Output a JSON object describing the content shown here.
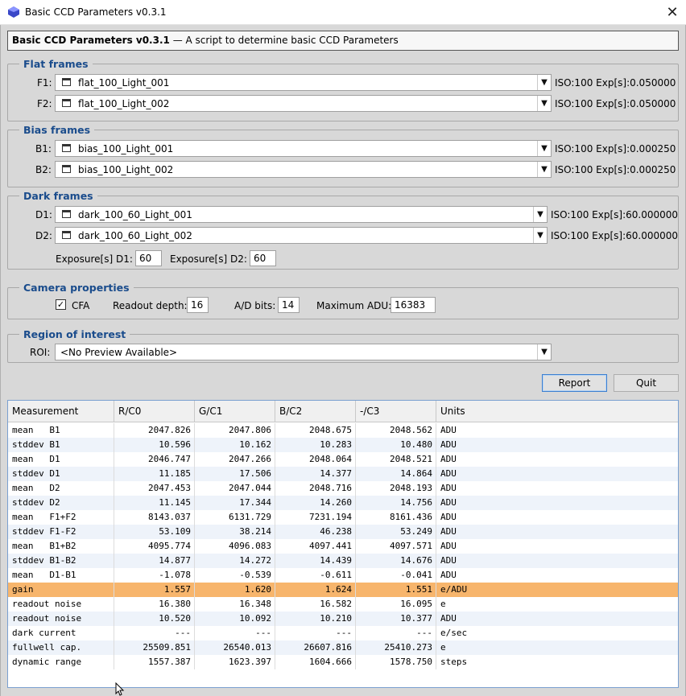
{
  "window": {
    "title": "Basic CCD Parameters v0.3.1",
    "close_glyph": "✕"
  },
  "header": {
    "name": "Basic CCD Parameters v0.3.1",
    "desc": " — A script to determine basic CCD Parameters"
  },
  "flat": {
    "legend": "Flat frames",
    "f1": {
      "label": "F1:",
      "value": "flat_100_Light_001",
      "info": "ISO:100 Exp[s]:0.050000"
    },
    "f2": {
      "label": "F2:",
      "value": "flat_100_Light_002",
      "info": "ISO:100 Exp[s]:0.050000"
    }
  },
  "bias": {
    "legend": "Bias frames",
    "b1": {
      "label": "B1:",
      "value": "bias_100_Light_001",
      "info": "ISO:100 Exp[s]:0.000250"
    },
    "b2": {
      "label": "B2:",
      "value": "bias_100_Light_002",
      "info": "ISO:100 Exp[s]:0.000250"
    }
  },
  "dark": {
    "legend": "Dark frames",
    "d1": {
      "label": "D1:",
      "value": "dark_100_60_Light_001",
      "info": "ISO:100 Exp[s]:60.000000"
    },
    "d2": {
      "label": "D2:",
      "value": "dark_100_60_Light_002",
      "info": "ISO:100 Exp[s]:60.000000"
    },
    "exp_d1_label": "Exposure[s] D1:",
    "exp_d1": "60",
    "exp_d2_label": "Exposure[s] D2:",
    "exp_d2": "60"
  },
  "camera": {
    "legend": "Camera properties",
    "cfa_label": "CFA",
    "cfa_checked": true,
    "check_glyph": "✓",
    "readout_label": "Readout depth:",
    "readout": "16",
    "adbits_label": "A/D bits:",
    "adbits": "14",
    "maxadu_label": "Maximum ADU:",
    "maxadu": "16383"
  },
  "roi": {
    "legend": "Region of interest",
    "label": "ROI:",
    "value": "<No Preview Available>"
  },
  "buttons": {
    "report": "Report",
    "quit": "Quit"
  },
  "table": {
    "headers": [
      "Measurement",
      "R/C0",
      "G/C1",
      "B/C2",
      "-/C3",
      "Units"
    ],
    "rows": [
      {
        "m": "mean   B1",
        "r": "2047.826",
        "g": "2047.806",
        "b": "2048.675",
        "c3": "2048.562",
        "u": "ADU"
      },
      {
        "m": "stddev B1",
        "r": "10.596",
        "g": "10.162",
        "b": "10.283",
        "c3": "10.480",
        "u": "ADU"
      },
      {
        "m": "mean   D1",
        "r": "2046.747",
        "g": "2047.266",
        "b": "2048.064",
        "c3": "2048.521",
        "u": "ADU"
      },
      {
        "m": "stddev D1",
        "r": "11.185",
        "g": "17.506",
        "b": "14.377",
        "c3": "14.864",
        "u": "ADU"
      },
      {
        "m": "mean   D2",
        "r": "2047.453",
        "g": "2047.044",
        "b": "2048.716",
        "c3": "2048.193",
        "u": "ADU"
      },
      {
        "m": "stddev D2",
        "r": "11.145",
        "g": "17.344",
        "b": "14.260",
        "c3": "14.756",
        "u": "ADU"
      },
      {
        "m": "mean   F1+F2",
        "r": "8143.037",
        "g": "6131.729",
        "b": "7231.194",
        "c3": "8161.436",
        "u": "ADU"
      },
      {
        "m": "stddev F1-F2",
        "r": "53.109",
        "g": "38.214",
        "b": "46.238",
        "c3": "53.249",
        "u": "ADU"
      },
      {
        "m": "mean   B1+B2",
        "r": "4095.774",
        "g": "4096.083",
        "b": "4097.441",
        "c3": "4097.571",
        "u": "ADU"
      },
      {
        "m": "stddev B1-B2",
        "r": "14.877",
        "g": "14.272",
        "b": "14.439",
        "c3": "14.676",
        "u": "ADU"
      },
      {
        "m": "mean   D1-B1",
        "r": "-1.078",
        "g": "-0.539",
        "b": "-0.611",
        "c3": "-0.041",
        "u": "ADU"
      },
      {
        "m": "gain",
        "r": "1.557",
        "g": "1.620",
        "b": "1.624",
        "c3": "1.551",
        "u": "e/ADU",
        "highlight": true
      },
      {
        "m": "readout noise",
        "r": "16.380",
        "g": "16.348",
        "b": "16.582",
        "c3": "16.095",
        "u": "e"
      },
      {
        "m": "readout noise",
        "r": "10.520",
        "g": "10.092",
        "b": "10.210",
        "c3": "10.377",
        "u": "ADU"
      },
      {
        "m": "dark current",
        "r": "---",
        "g": "---",
        "b": "---",
        "c3": "---",
        "u": "e/sec"
      },
      {
        "m": "fullwell cap.",
        "r": "25509.851",
        "g": "26540.013",
        "b": "26607.816",
        "c3": "25410.273",
        "u": "e"
      },
      {
        "m": "dynamic range",
        "r": "1557.387",
        "g": "1623.397",
        "b": "1604.666",
        "c3": "1578.750",
        "u": "steps"
      }
    ]
  },
  "colors": {
    "legend": "#1a4c8c",
    "highlight_row": "#f7b56c",
    "alt_row": "#eef3fa"
  }
}
